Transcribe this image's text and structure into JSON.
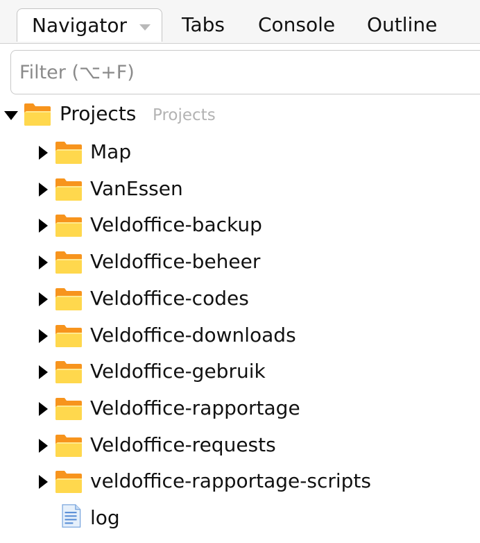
{
  "tabs": [
    {
      "label": "Navigator"
    },
    {
      "label": "Tabs"
    },
    {
      "label": "Console"
    },
    {
      "label": "Outline"
    }
  ],
  "filter": {
    "placeholder": "Filter (⌥+F)",
    "value": ""
  },
  "tree": {
    "root": {
      "label": "Projects",
      "sublabel": "Projects",
      "icon": "folder-icon",
      "expanded": true
    },
    "items": [
      {
        "label": "Map",
        "icon": "folder-icon"
      },
      {
        "label": "VanEssen",
        "icon": "folder-icon"
      },
      {
        "label": "Veldoffice-backup",
        "icon": "folder-icon"
      },
      {
        "label": "Veldoffice-beheer",
        "icon": "folder-icon"
      },
      {
        "label": "Veldoffice-codes",
        "icon": "folder-icon"
      },
      {
        "label": "Veldoffice-downloads",
        "icon": "folder-icon"
      },
      {
        "label": "Veldoffice-gebruik",
        "icon": "folder-icon"
      },
      {
        "label": "Veldoffice-rapportage",
        "icon": "folder-icon"
      },
      {
        "label": "Veldoffice-requests",
        "icon": "folder-icon"
      },
      {
        "label": "veldoffice-rapportage-scripts",
        "icon": "folder-icon"
      },
      {
        "label": "log",
        "icon": "file-icon"
      }
    ]
  },
  "colors": {
    "folder_back": "#f7941d",
    "folder_front": "#ffd84d",
    "file_blue": "#5b8fd6"
  }
}
